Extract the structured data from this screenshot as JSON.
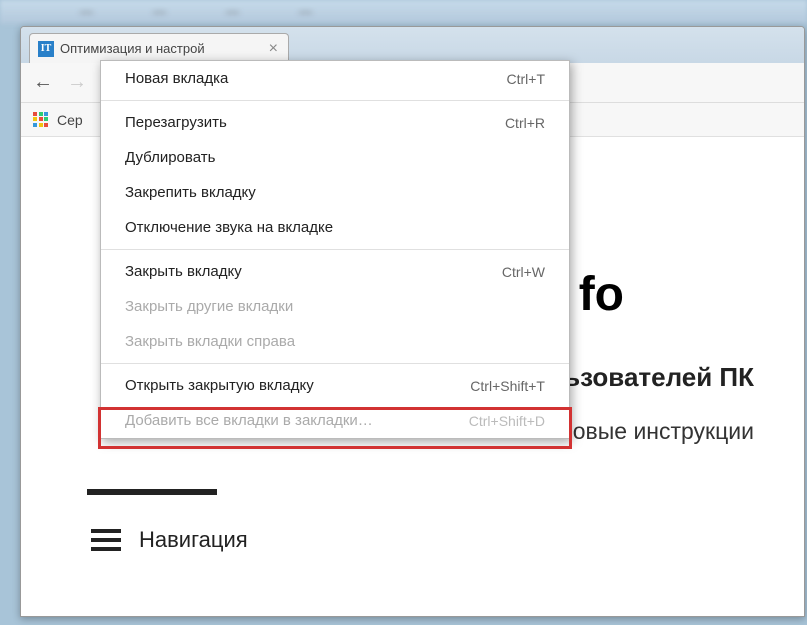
{
  "tab": {
    "favicon_text": "IT",
    "title": "Оптимизация и настрой"
  },
  "bookmarks": {
    "apps_label": "Сер"
  },
  "page": {
    "title_fragment": "fo",
    "subtitle1": "ьзователей ПК",
    "subtitle2": "овые инструкции",
    "nav_label": "Навигация"
  },
  "menu": {
    "items": [
      {
        "label": "Новая вкладка",
        "shortcut": "Ctrl+T",
        "disabled": false
      },
      {
        "label": "Перезагрузить",
        "shortcut": "Ctrl+R",
        "disabled": false
      },
      {
        "label": "Дублировать",
        "shortcut": "",
        "disabled": false
      },
      {
        "label": "Закрепить вкладку",
        "shortcut": "",
        "disabled": false
      },
      {
        "label": "Отключение звука на вкладке",
        "shortcut": "",
        "disabled": false
      },
      {
        "label": "Закрыть вкладку",
        "shortcut": "Ctrl+W",
        "disabled": false
      },
      {
        "label": "Закрыть другие вкладки",
        "shortcut": "",
        "disabled": true
      },
      {
        "label": "Закрыть вкладки справа",
        "shortcut": "",
        "disabled": true
      },
      {
        "label": "Открыть закрытую вкладку",
        "shortcut": "Ctrl+Shift+T",
        "disabled": false
      },
      {
        "label": "Добавить все вкладки в закладки…",
        "shortcut": "Ctrl+Shift+D",
        "disabled": true
      }
    ]
  }
}
